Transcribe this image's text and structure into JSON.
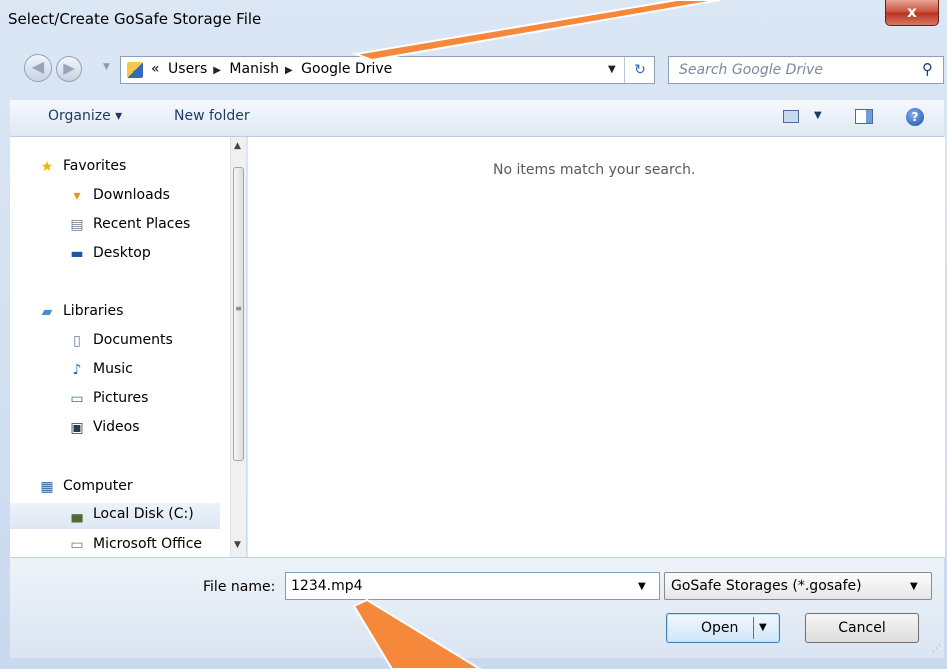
{
  "window": {
    "title": "Select/Create GoSafe Storage File",
    "close_label": "x"
  },
  "nav": {
    "back_glyph": "◀",
    "forward_glyph": "▶",
    "breadcrumb_prefix": "«",
    "breadcrumbs": [
      "Users",
      "Manish",
      "Google Drive"
    ],
    "refresh_glyph": "↻"
  },
  "search": {
    "placeholder": "Search Google Drive",
    "icon": "search-icon"
  },
  "toolbar": {
    "organize_label": "Organize ▾",
    "new_folder_label": "New folder",
    "help_label": "?"
  },
  "sidebar": {
    "items": [
      {
        "label": "Favorites",
        "icon": "star-icon",
        "glyph": "★"
      },
      {
        "label": "Downloads",
        "icon": "downloads-folder-icon",
        "glyph": "▾"
      },
      {
        "label": "Recent Places",
        "icon": "recent-places-icon",
        "glyph": "▤"
      },
      {
        "label": "Desktop",
        "icon": "desktop-icon",
        "glyph": "▬"
      },
      {
        "label": "Libraries",
        "icon": "libraries-icon",
        "glyph": "▰"
      },
      {
        "label": "Documents",
        "icon": "document-icon",
        "glyph": "▯"
      },
      {
        "label": "Music",
        "icon": "music-icon",
        "glyph": "♪"
      },
      {
        "label": "Pictures",
        "icon": "pictures-icon",
        "glyph": "▭"
      },
      {
        "label": "Videos",
        "icon": "videos-icon",
        "glyph": "▣"
      },
      {
        "label": "Computer",
        "icon": "computer-icon",
        "glyph": "▦"
      },
      {
        "label": "Local Disk (C:)",
        "icon": "local-disk-icon",
        "glyph": "▄"
      },
      {
        "label": "Microsoft Office",
        "icon": "drive-icon",
        "glyph": "▭"
      }
    ]
  },
  "content": {
    "empty_message": "No items match your search."
  },
  "footer": {
    "file_name_label": "File name:",
    "file_name_value": "1234.mp4",
    "file_type_value": "GoSafe Storages (*.gosafe)",
    "open_label": "Open",
    "cancel_label": "Cancel"
  },
  "colors": {
    "annotation_arrow": "#f5883a",
    "accent": "#2f6db8"
  }
}
